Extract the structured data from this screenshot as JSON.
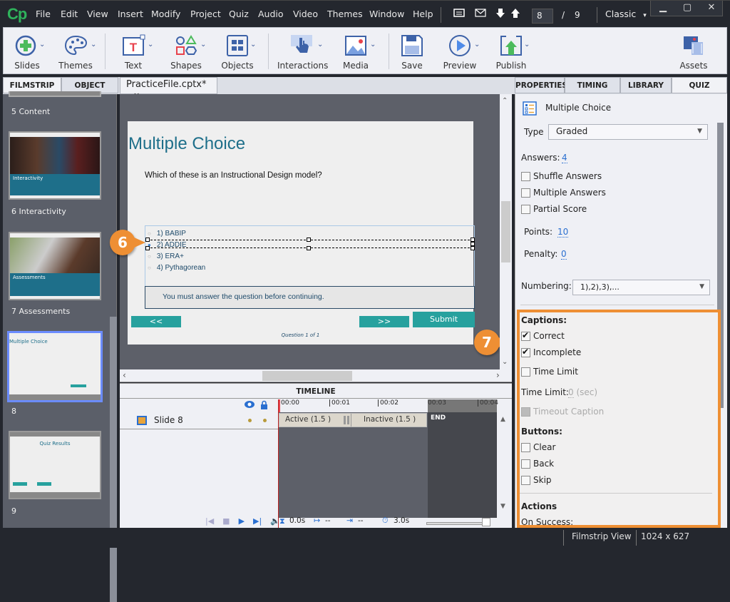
{
  "app": {
    "logo": "Cp",
    "brand_color": "#2fb35c"
  },
  "menu": [
    "File",
    "Edit",
    "View",
    "Insert",
    "Modify",
    "Project",
    "Quiz",
    "Audio",
    "Video",
    "Themes",
    "Window",
    "Help"
  ],
  "nav": {
    "current_slide": "8",
    "separator": "/",
    "total_slides": "9",
    "workspace": "Classic",
    "workspace_caret": "▾"
  },
  "window_buttons": {
    "minimize": "▁",
    "maximize": "▢",
    "close": "✕"
  },
  "toolbar": {
    "slides": "Slides",
    "themes": "Themes",
    "text": "Text",
    "shapes": "Shapes",
    "objects": "Objects",
    "interactions": "Interactions",
    "media": "Media",
    "save": "Save",
    "preview": "Preview",
    "publish": "Publish",
    "assets": "Assets"
  },
  "left_tabs": {
    "filmstrip": "FILMSTRIP",
    "object_state": "OBJECT STATE"
  },
  "doc_tab": {
    "name": "PracticeFile.cptx*",
    "close": "×"
  },
  "filmstrip": {
    "items": [
      {
        "label": "5 Content"
      },
      {
        "label": "6 Interactivity",
        "thumb_title": "Interactivity"
      },
      {
        "label": "7 Assessments",
        "thumb_title": "Assessments"
      },
      {
        "label": "8",
        "thumb_title": "Multiple Choice",
        "selected": true
      },
      {
        "label": "9",
        "thumb_title": "Quiz Results"
      }
    ]
  },
  "slide": {
    "title": "Multiple Choice",
    "question": "Which of these is an Instructional Design model?",
    "answers": [
      "1) BABIP",
      "2) ADDIE",
      "3) ERA+",
      "4) Pythagorean"
    ],
    "selected_answer_index": 1,
    "incomplete_caption": "You must answer the question before continuing.",
    "back_button": "<<",
    "next_button": ">>",
    "submit_button": "Submit",
    "progress": "Question 1 of 1",
    "accent_color": "#27a19e",
    "title_color": "#1e6f8a"
  },
  "callouts": {
    "six": "6",
    "seven": "7"
  },
  "timeline": {
    "title": "TIMELINE",
    "row_label": "Slide 8",
    "ticks": [
      "00:00",
      "00:01",
      "00:02",
      "00:03",
      "00:04"
    ],
    "active": "Active (1.5 )",
    "inactive": "Inactive (1.5 )",
    "end": "END",
    "current_time": "0.0s",
    "start": "--",
    "duration_marker": "--",
    "total": "3.0s"
  },
  "right_tabs": {
    "properties": "PROPERTIES",
    "timing": "TIMING",
    "library": "LIBRARY",
    "quiz": "QUIZ"
  },
  "quiz": {
    "header": "Multiple Choice",
    "type_label": "Type",
    "type_value": "Graded",
    "answers_label": "Answers:",
    "answers_value": "4",
    "shuffle": {
      "label": "Shuffle Answers",
      "checked": false
    },
    "multiple": {
      "label": "Multiple Answers",
      "checked": false
    },
    "partial": {
      "label": "Partial Score",
      "checked": false
    },
    "points_label": "Points:",
    "points_value": "10",
    "penalty_label": "Penalty:",
    "penalty_value": "0",
    "numbering_label": "Numbering:",
    "numbering_value": "1),2),3),...",
    "captions_title": "Captions:",
    "correct": {
      "label": "Correct",
      "checked": true
    },
    "incomplete": {
      "label": "Incomplete",
      "checked": true
    },
    "time_limit_chk": {
      "label": "Time Limit",
      "checked": false
    },
    "time_limit_label": "Time Limit:",
    "time_limit_value": "0",
    "time_limit_unit": "(sec)",
    "timeout_caption": {
      "label": "Timeout Caption",
      "checked": false
    },
    "buttons_title": "Buttons:",
    "clear": {
      "label": "Clear",
      "checked": false
    },
    "back": {
      "label": "Back",
      "checked": false
    },
    "skip": {
      "label": "Skip",
      "checked": false
    },
    "actions_title": "Actions",
    "on_success": "On Success:",
    "highlight_color": "#ee8f34"
  },
  "status": {
    "view": "Filmstrip View",
    "resolution": "1024 x 627"
  }
}
